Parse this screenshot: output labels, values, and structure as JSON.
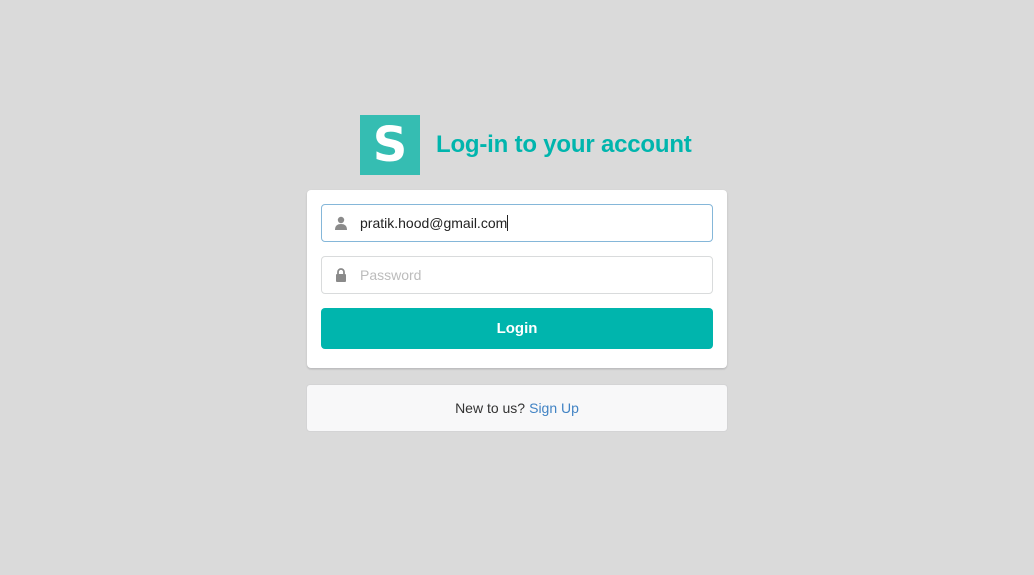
{
  "header": {
    "logo_letter": "S",
    "title": "Log-in to your account"
  },
  "form": {
    "email": {
      "value": "pratik.hood@gmail.com",
      "icon": "user-icon"
    },
    "password": {
      "placeholder": "Password",
      "value": "",
      "icon": "lock-icon"
    },
    "login_label": "Login"
  },
  "signup": {
    "prompt": "New to us?",
    "link_label": "Sign Up"
  },
  "colors": {
    "accent": "#00b5ad",
    "logo_bg": "#35bdb2",
    "link": "#4183c4",
    "background": "#dadada"
  }
}
